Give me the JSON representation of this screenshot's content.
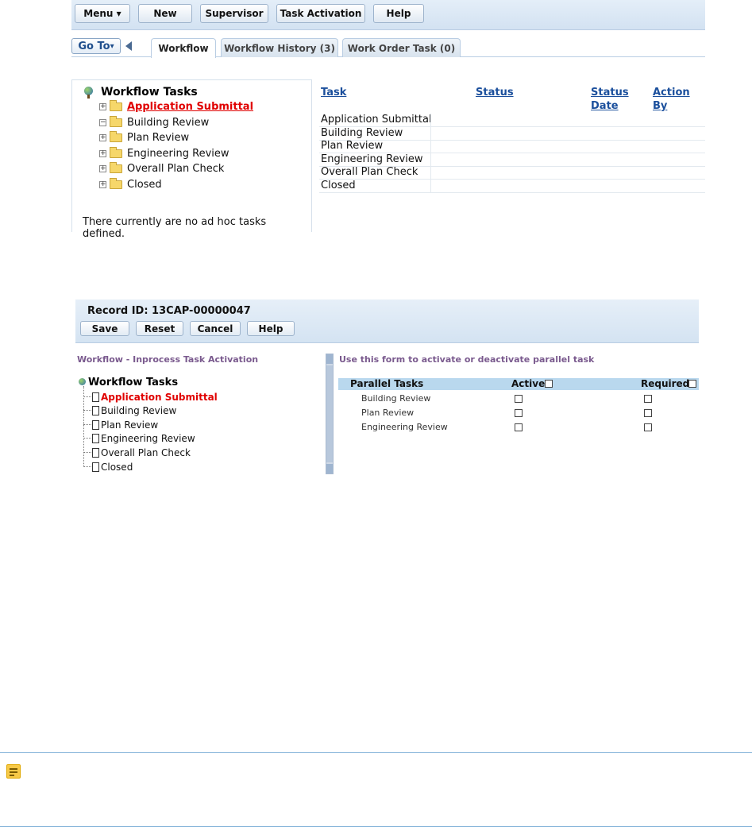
{
  "workflow_screen": {
    "toolbar": {
      "menu": "Menu",
      "menu_arrow": "▾",
      "new": "New",
      "supervisor": "Supervisor",
      "task_activation": "Task Activation",
      "help": "Help"
    },
    "goto": "Go To",
    "goto_arrow": "▾",
    "tabs": [
      "Workflow",
      "Workflow History (3)",
      "Work Order Task (0)"
    ],
    "tree": {
      "title": "Workflow Tasks",
      "items": [
        {
          "label": "Application Submittal",
          "expander": "+"
        },
        {
          "label": "Building Review",
          "expander": "−"
        },
        {
          "label": "Plan Review",
          "expander": "+"
        },
        {
          "label": "Engineering Review",
          "expander": "+"
        },
        {
          "label": "Overall Plan Check",
          "expander": "+"
        },
        {
          "label": "Closed",
          "expander": "+"
        }
      ]
    },
    "adhoc_message": "There currently are no ad hoc tasks defined.",
    "table": {
      "headers": {
        "task": "Task",
        "status": "Status",
        "status_date_1": "Status",
        "status_date_2": "Date",
        "action_by": "Action By"
      },
      "rows": [
        "Application Submittal",
        "Building Review",
        "Plan Review",
        "Engineering Review",
        "Overall Plan Check",
        "Closed"
      ]
    }
  },
  "activation_screen": {
    "record_id": "Record ID: 13CAP-00000047",
    "buttons": {
      "save": "Save",
      "reset": "Reset",
      "cancel": "Cancel",
      "help": "Help"
    },
    "left_heading": "Workflow - Inprocess Task Activation",
    "tree": {
      "title": "Workflow Tasks",
      "items": [
        "Application Submittal",
        "Building Review",
        "Plan Review",
        "Engineering Review",
        "Overall Plan Check",
        "Closed"
      ]
    },
    "form_heading": "Use this form to activate or deactivate parallel task",
    "parallel_table": {
      "headers": {
        "tasks": "Parallel Tasks",
        "active": "Active",
        "required": "Required"
      },
      "rows": [
        "Building Review",
        "Plan Review",
        "Engineering Review"
      ]
    }
  },
  "colors": {
    "selected_task": "#e00000",
    "link": "#1b4f9c",
    "heading": "#7a5a8e"
  },
  "icons": [
    "globe-icon",
    "folder-icon",
    "expander-icon",
    "document-icon",
    "note-icon",
    "back-arrow-icon",
    "scroll-up-icon",
    "scroll-down-icon"
  ]
}
